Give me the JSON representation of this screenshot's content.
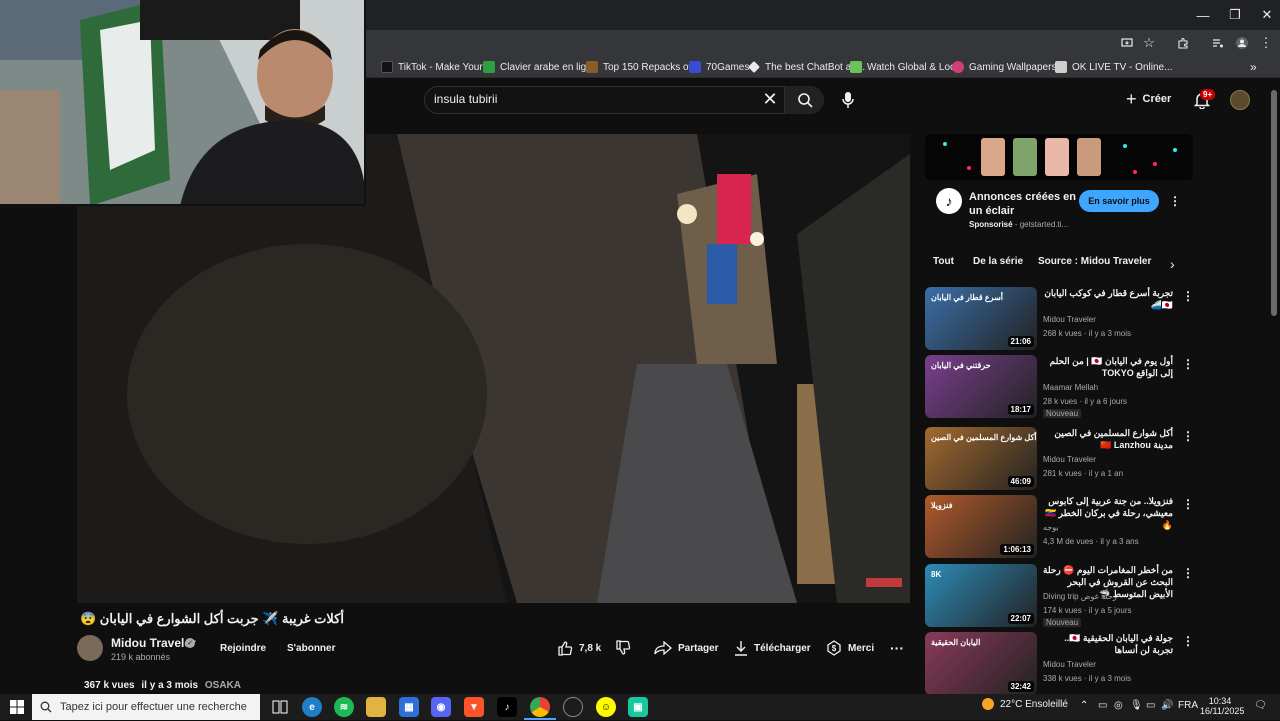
{
  "window_controls": [
    "—",
    "❐",
    "✕"
  ],
  "bookmarks": [
    {
      "label": "TikTok - Make Your...",
      "color": "#111111"
    },
    {
      "label": "Clavier arabe en lig...",
      "color": "#2ea043"
    },
    {
      "label": "Top 150 Repacks of...",
      "color": "#8a5a2b"
    },
    {
      "label": "70Games",
      "color": "#3a4bd6"
    },
    {
      "label": "The best ChatBot an...",
      "color": "#e8eaed"
    },
    {
      "label": "Watch Global & Loc...",
      "color": "#6ac259"
    },
    {
      "label": "Gaming Wallpapers...",
      "color": "#d13c7a"
    },
    {
      "label": "OK LIVE TV - Online...",
      "color": "#cfcfcf"
    }
  ],
  "header": {
    "search_value": "insula tubirii",
    "create_label": "Créer",
    "notif_count": "9+"
  },
  "video": {
    "title": "أكلات غريبة ✈️ جربت أكل الشوارع في اليابان 😨",
    "channel": "Midou Traveler",
    "subscribers": "219 k abonnés",
    "join_label": "Rejoindre",
    "subscribe_label": "S'abonner",
    "likes": "7,8 k",
    "share_label": "Partager",
    "download_label": "Télécharger",
    "thanks_label": "Merci",
    "views": "367 k vues",
    "age": "il y a 3 mois",
    "tag": "OSAKA"
  },
  "ad": {
    "title": "Annonces créées en un éclair",
    "sponsored": "Sponsorisé",
    "domain": "getstarted.ti...",
    "cta": "En savoir plus"
  },
  "chips": [
    "Tout",
    "De la série",
    "Source : Midou Traveler"
  ],
  "related": [
    {
      "title": "تجربة أسرع قطار في كوكب اليابان 🇯🇵🚄",
      "channel": "Midou Traveler",
      "meta": "268 k vues · il y a 3 mois",
      "duration": "21:06",
      "badge": "",
      "thumb_text": "أسرع قطار في اليابان",
      "thumb_color": "#3b6fa8"
    },
    {
      "title": "أول يوم في اليابان 🇯🇵 | من الحلم إلى الواقع TOKYO",
      "channel": "Maamar Mellah",
      "meta": "28 k vues · il y a 6 jours",
      "duration": "18:17",
      "badge": "Nouveau",
      "thumb_text": "حرقتني في اليابان",
      "thumb_color": "#7a3f8f"
    },
    {
      "title": "أكل شوارع المسلمين في الصين مدينة 🇨🇳 Lanzhou",
      "channel": "Midou Traveler",
      "meta": "281 k vues · il y a 1 an",
      "duration": "46:09",
      "badge": "",
      "thumb_text": "أكل شوارع المسلمين في الصين",
      "thumb_color": "#a36a2e"
    },
    {
      "title": "فنزويلا.. من جنة عربية إلى كابوس معيشي، رحلة في بركان الخطر 🇻🇪🔥",
      "channel": "بوجه",
      "meta": "4,3 M de vues · il y a 3 ans",
      "duration": "1:06:13",
      "badge": "",
      "thumb_text": "فنزويلا",
      "thumb_color": "#b05a2a"
    },
    {
      "title": "من أخطر المغامرات اليوم ⛔ رحلة البحث عن القروش في البحر الأبيض المتوسط 🦈",
      "channel": "Diving trip رحلة غوص",
      "meta": "174 k vues · il y a 5 jours",
      "duration": "22:07",
      "badge": "Nouveau",
      "thumb_text": "8K",
      "thumb_color": "#2d8bb8"
    },
    {
      "title": "جولة في اليابان الحقيقية 🇯🇵.. تجربة لن أنساها",
      "channel": "Midou Traveler",
      "meta": "338 k vues · il y a 3 mois",
      "duration": "32:42",
      "badge": "",
      "thumb_text": "اليابان الحقيقية",
      "thumb_color": "#8a3a5a"
    }
  ],
  "taskbar": {
    "search_placeholder": "Tapez ici pour effectuer une recherche",
    "weather": "22°C Ensoleillé",
    "lang": "FRA",
    "time": "10:34",
    "date": "16/11/2025"
  }
}
